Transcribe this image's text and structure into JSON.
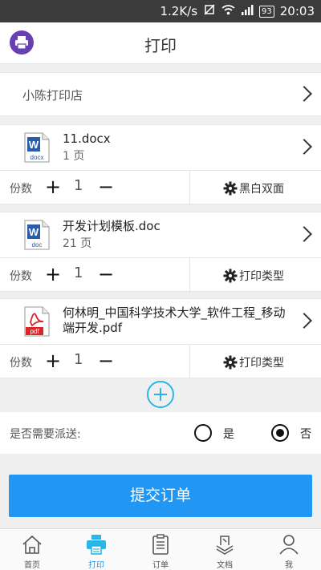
{
  "status_bar": {
    "network_speed": "1.2K/s",
    "battery": "93",
    "time": "20:03"
  },
  "app_bar": {
    "title": "打印",
    "logo_icon": "printer-icon"
  },
  "store": {
    "name": "小陈打印店"
  },
  "files": [
    {
      "name": "11.docx",
      "pages": "1 页",
      "icon": "word-docx-icon",
      "icon_text": "docx",
      "count_label": "份数",
      "quantity": "1",
      "option_label": "黑白双面"
    },
    {
      "name": "开发计划模板.doc",
      "pages": "21 页",
      "icon": "word-doc-icon",
      "icon_text": "doc",
      "count_label": "份数",
      "quantity": "1",
      "option_label": "打印类型"
    },
    {
      "name": "何林明_中国科学技术大学_软件工程_移动端开发.pdf",
      "pages": "",
      "icon": "pdf-icon",
      "icon_text": "pdf",
      "count_label": "份数",
      "quantity": "1",
      "option_label": "打印类型"
    }
  ],
  "delivery": {
    "question": "是否需要派送:",
    "yes_label": "是",
    "no_label": "否",
    "selected": "否"
  },
  "submit": {
    "label": "提交订单"
  },
  "bottom_nav": {
    "items": [
      {
        "label": "首页",
        "icon": "home-icon"
      },
      {
        "label": "打印",
        "icon": "printer-icon",
        "active": true
      },
      {
        "label": "订单",
        "icon": "clipboard-icon"
      },
      {
        "label": "文档",
        "icon": "document-icon"
      },
      {
        "label": "我",
        "icon": "user-icon"
      }
    ]
  },
  "colors": {
    "accent": "#2196f3",
    "add_button": "#2bb5e6",
    "logo_bg": "#6a3fb4",
    "pdf_red": "#d9262b",
    "word_blue": "#2a5cad"
  }
}
